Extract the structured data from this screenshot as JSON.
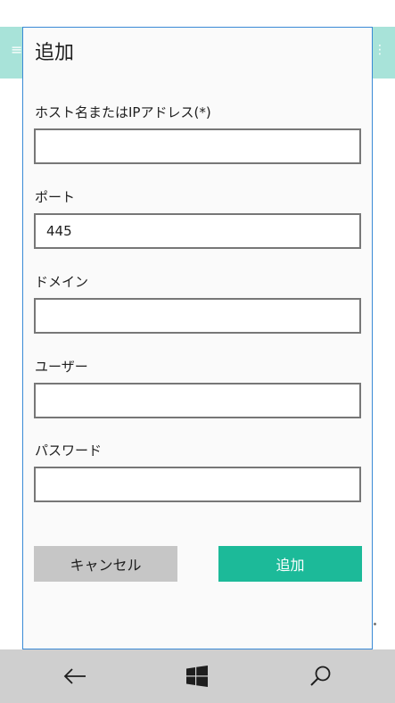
{
  "background_app": {
    "header_color": "#a8e3d9",
    "menu_icon": "hamburger-icon",
    "right_icon": "more-icon"
  },
  "dialog": {
    "title": "追加",
    "fields": {
      "host": {
        "label": "ホスト名またはIPアドレス(*)",
        "value": ""
      },
      "port": {
        "label": "ポート",
        "value": "445"
      },
      "domain": {
        "label": "ドメイン",
        "value": ""
      },
      "user": {
        "label": "ユーザー",
        "value": ""
      },
      "password": {
        "label": "パスワード",
        "value": ""
      }
    },
    "cancel_label": "キャンセル",
    "add_label": "追加",
    "accent_color": "#1cba99"
  },
  "navbar": {
    "back_icon": "back-arrow-icon",
    "home_icon": "windows-logo-icon",
    "search_icon": "search-icon"
  }
}
